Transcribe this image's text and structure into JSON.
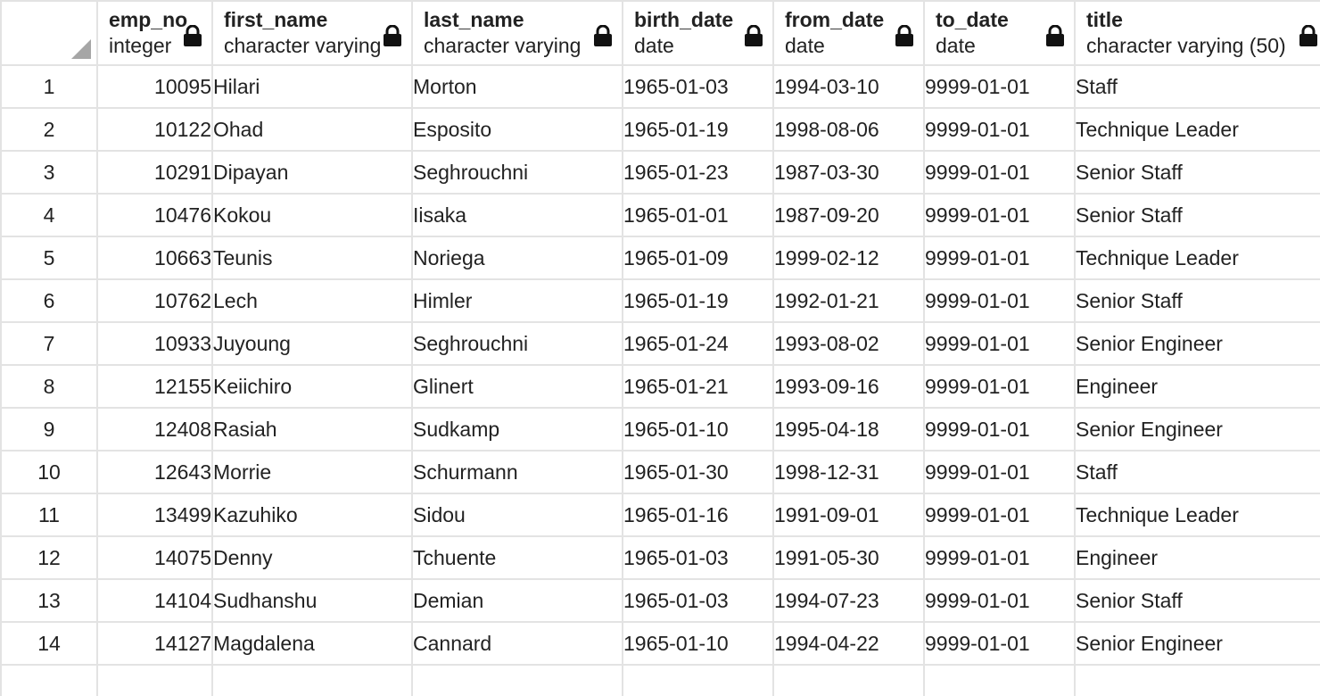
{
  "columns": [
    {
      "name": "emp_no",
      "type": "integer"
    },
    {
      "name": "first_name",
      "type": "character varying"
    },
    {
      "name": "last_name",
      "type": "character varying"
    },
    {
      "name": "birth_date",
      "type": "date"
    },
    {
      "name": "from_date",
      "type": "date"
    },
    {
      "name": "to_date",
      "type": "date"
    },
    {
      "name": "title",
      "type": "character varying (50)"
    }
  ],
  "rows": [
    {
      "idx": "1",
      "emp_no": "10095",
      "first_name": "Hilari",
      "last_name": "Morton",
      "birth_date": "1965-01-03",
      "from_date": "1994-03-10",
      "to_date": "9999-01-01",
      "title": "Staff"
    },
    {
      "idx": "2",
      "emp_no": "10122",
      "first_name": "Ohad",
      "last_name": "Esposito",
      "birth_date": "1965-01-19",
      "from_date": "1998-08-06",
      "to_date": "9999-01-01",
      "title": "Technique Leader"
    },
    {
      "idx": "3",
      "emp_no": "10291",
      "first_name": "Dipayan",
      "last_name": "Seghrouchni",
      "birth_date": "1965-01-23",
      "from_date": "1987-03-30",
      "to_date": "9999-01-01",
      "title": "Senior Staff"
    },
    {
      "idx": "4",
      "emp_no": "10476",
      "first_name": "Kokou",
      "last_name": "Iisaka",
      "birth_date": "1965-01-01",
      "from_date": "1987-09-20",
      "to_date": "9999-01-01",
      "title": "Senior Staff"
    },
    {
      "idx": "5",
      "emp_no": "10663",
      "first_name": "Teunis",
      "last_name": "Noriega",
      "birth_date": "1965-01-09",
      "from_date": "1999-02-12",
      "to_date": "9999-01-01",
      "title": "Technique Leader"
    },
    {
      "idx": "6",
      "emp_no": "10762",
      "first_name": "Lech",
      "last_name": "Himler",
      "birth_date": "1965-01-19",
      "from_date": "1992-01-21",
      "to_date": "9999-01-01",
      "title": "Senior Staff"
    },
    {
      "idx": "7",
      "emp_no": "10933",
      "first_name": "Juyoung",
      "last_name": "Seghrouchni",
      "birth_date": "1965-01-24",
      "from_date": "1993-08-02",
      "to_date": "9999-01-01",
      "title": "Senior Engineer"
    },
    {
      "idx": "8",
      "emp_no": "12155",
      "first_name": "Keiichiro",
      "last_name": "Glinert",
      "birth_date": "1965-01-21",
      "from_date": "1993-09-16",
      "to_date": "9999-01-01",
      "title": "Engineer"
    },
    {
      "idx": "9",
      "emp_no": "12408",
      "first_name": "Rasiah",
      "last_name": "Sudkamp",
      "birth_date": "1965-01-10",
      "from_date": "1995-04-18",
      "to_date": "9999-01-01",
      "title": "Senior Engineer"
    },
    {
      "idx": "10",
      "emp_no": "12643",
      "first_name": "Morrie",
      "last_name": "Schurmann",
      "birth_date": "1965-01-30",
      "from_date": "1998-12-31",
      "to_date": "9999-01-01",
      "title": "Staff"
    },
    {
      "idx": "11",
      "emp_no": "13499",
      "first_name": "Kazuhiko",
      "last_name": "Sidou",
      "birth_date": "1965-01-16",
      "from_date": "1991-09-01",
      "to_date": "9999-01-01",
      "title": "Technique Leader"
    },
    {
      "idx": "12",
      "emp_no": "14075",
      "first_name": "Denny",
      "last_name": "Tchuente",
      "birth_date": "1965-01-03",
      "from_date": "1991-05-30",
      "to_date": "9999-01-01",
      "title": "Engineer"
    },
    {
      "idx": "13",
      "emp_no": "14104",
      "first_name": "Sudhanshu",
      "last_name": "Demian",
      "birth_date": "1965-01-03",
      "from_date": "1994-07-23",
      "to_date": "9999-01-01",
      "title": "Senior Staff"
    },
    {
      "idx": "14",
      "emp_no": "14127",
      "first_name": "Magdalena",
      "last_name": "Cannard",
      "birth_date": "1965-01-10",
      "from_date": "1994-04-22",
      "to_date": "9999-01-01",
      "title": "Senior Engineer"
    }
  ],
  "icons": {
    "column_lock": "lock-icon",
    "corner": "resize-corner-icon"
  },
  "colors": {
    "grid_line": "#e3e3e3",
    "text": "#222222",
    "icon": "#111111",
    "corner": "#a6a6a6"
  }
}
